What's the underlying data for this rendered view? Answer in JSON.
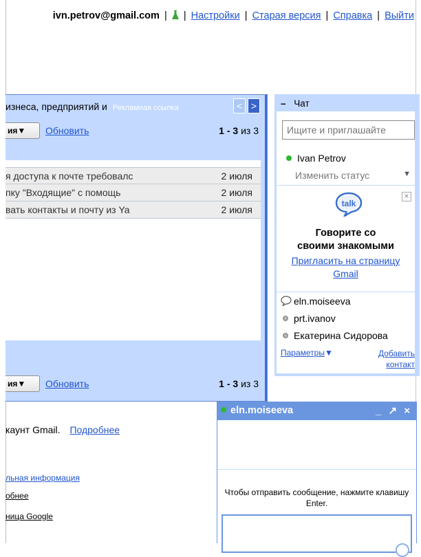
{
  "topbar": {
    "email": "ivn.petrov@gmail.com",
    "sep1": "|",
    "sep2": "|",
    "settings": "Настройки",
    "sep3": "|",
    "old_version": "Старая версия",
    "sep4": "|",
    "help": "Справка",
    "sep5": "|",
    "logout": "Выйти"
  },
  "mail": {
    "ad_text": "изнеса, предприятий и",
    "ad_link": "Рекламная ссылка",
    "nav_prev": "<",
    "nav_next": ">",
    "top_toolbar": {
      "dropdown": "ия▼",
      "refresh": "Обновить",
      "count_range": "1 - 3",
      "count_of": "из 3"
    },
    "bottom_toolbar": {
      "dropdown": "ия▼",
      "refresh": "Обновить",
      "count_range": "1 - 3",
      "count_of": "из 3"
    },
    "messages": [
      {
        "subject": "я доступа к почте требовалс",
        "date": "2 июля"
      },
      {
        "subject": "пку \"Входящие\" с помощь",
        "date": "2 июля"
      },
      {
        "subject": "вать контакты и почту из Ya",
        "date": "2 июля"
      }
    ]
  },
  "chat": {
    "title": "Чат",
    "minus": "–",
    "search_placeholder": "Ищите и приглашайте",
    "me_name": "Ivan Petrov",
    "change_status": "Изменить статус",
    "status_arrow": "▼",
    "close": "×",
    "promo_line1": "Говорите со",
    "promo_line2": "своими знакомыми",
    "promo_link1": "Пригласить на страницу",
    "promo_link2": "Gmail",
    "contacts": [
      {
        "name": "eln.moiseeva"
      },
      {
        "name": "prt.ivanov"
      },
      {
        "name": "Екатерина Сидорова"
      }
    ],
    "params": "Параметры",
    "params_arrow": "▼",
    "add_contact1": "Добавить",
    "add_contact2": "контакт"
  },
  "below": {
    "account_text": "каунт Gmail.",
    "more_link": "Подробнее",
    "info_link": "льная информация",
    "more_small": "обнее",
    "google_page": "ница Google"
  },
  "chat_window": {
    "contact": "eln.moiseeva",
    "controls": "_ ↗ ×",
    "note": "Чтобы отправить сообщение, нажмите клавишу Enter."
  },
  "colors": {
    "panel_blue": "#c3d9ff",
    "header_blue": "#6a96e0",
    "link_blue": "#2255cc",
    "online_green": "#2eb82e"
  }
}
